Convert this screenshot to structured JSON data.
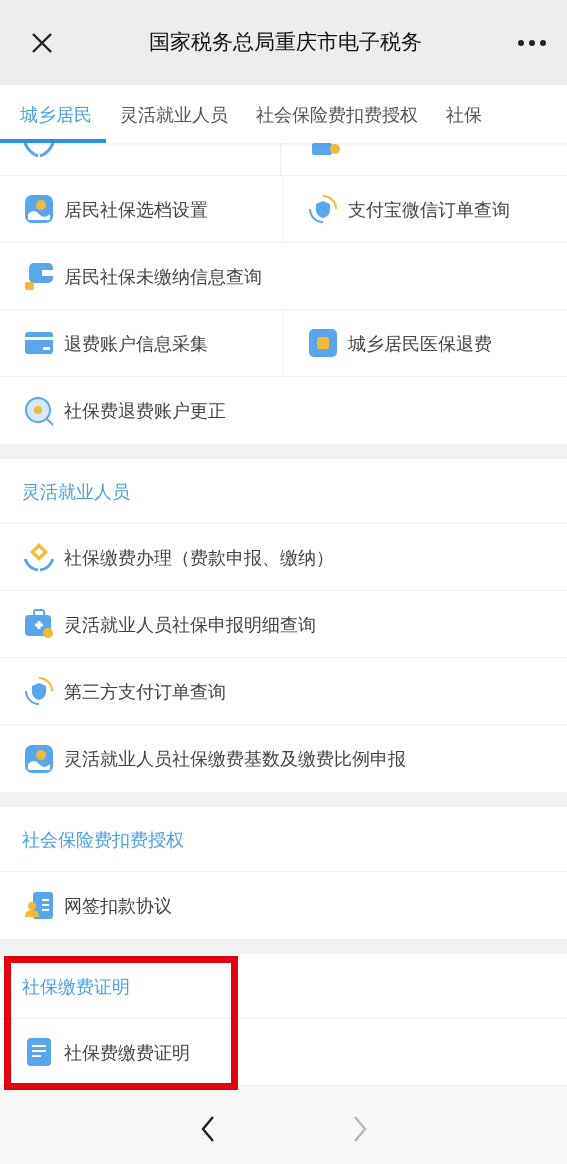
{
  "header": {
    "title": "国家税务总局重庆市电子税务"
  },
  "tabs": [
    {
      "label": "城乡居民",
      "selected": true
    },
    {
      "label": "灵活就业人员",
      "selected": false
    },
    {
      "label": "社会保险费扣费授权",
      "selected": false
    },
    {
      "label": "社保",
      "selected": false
    }
  ],
  "sections": [
    {
      "highlighted": false,
      "rows": [
        [
          {
            "label": "居民社保选档设置"
          },
          {
            "label": "支付宝微信订单查询"
          }
        ],
        [
          {
            "label": "居民社保未缴纳信息查询"
          }
        ],
        [
          {
            "label": "退费账户信息采集"
          },
          {
            "label": "城乡居民医保退费"
          }
        ],
        [
          {
            "label": "社保费退费账户更正"
          }
        ]
      ]
    },
    {
      "title": "灵活就业人员",
      "highlighted": false,
      "rows": [
        [
          {
            "label": "社保缴费办理（费款申报、缴纳）"
          }
        ],
        [
          {
            "label": "灵活就业人员社保申报明细查询"
          }
        ],
        [
          {
            "label": "第三方支付订单查询"
          }
        ],
        [
          {
            "label": "灵活就业人员社保缴费基数及缴费比例申报"
          }
        ]
      ]
    },
    {
      "title": "社会保险费扣费授权",
      "highlighted": false,
      "rows": [
        [
          {
            "label": "网签扣款协议"
          }
        ]
      ]
    },
    {
      "title": "社保缴费证明",
      "highlighted": true,
      "rows": [
        [
          {
            "label": "社保费缴费证明"
          }
        ]
      ]
    }
  ],
  "nav": {
    "back": {
      "disabled": false
    },
    "forward": {
      "disabled": true
    }
  }
}
